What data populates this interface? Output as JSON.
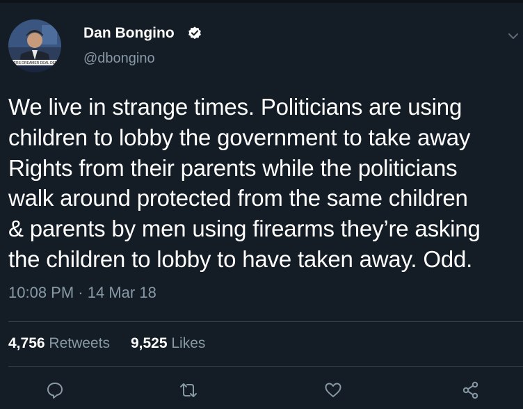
{
  "author": {
    "name": "Dan Bongino",
    "handle": "@dbongino",
    "avatar_caption": "DERS DREAMER DEAL DEM"
  },
  "tweet": {
    "text": "We live in strange times. Politicians are using\nchildren to lobby the government to take away\nRights from their parents while the politicians\nwalk around protected from the same children\n& parents by men using firearms they’re asking\nthe children to lobby to have taken away. Odd.",
    "time": "10:08 PM",
    "separator": "·",
    "date": "14 Mar 18"
  },
  "stats": {
    "retweets_count": "4,756",
    "retweets_label": "Retweets",
    "likes_count": "9,525",
    "likes_label": "Likes"
  },
  "icons": {
    "verified": "verified-badge-icon",
    "menu": "chevron-down-icon",
    "reply": "reply-icon",
    "retweet": "retweet-icon",
    "like": "heart-icon",
    "share": "share-icon"
  },
  "colors": {
    "background": "#141d26",
    "secondary_text": "#8899a6",
    "divider": "#38444d"
  }
}
